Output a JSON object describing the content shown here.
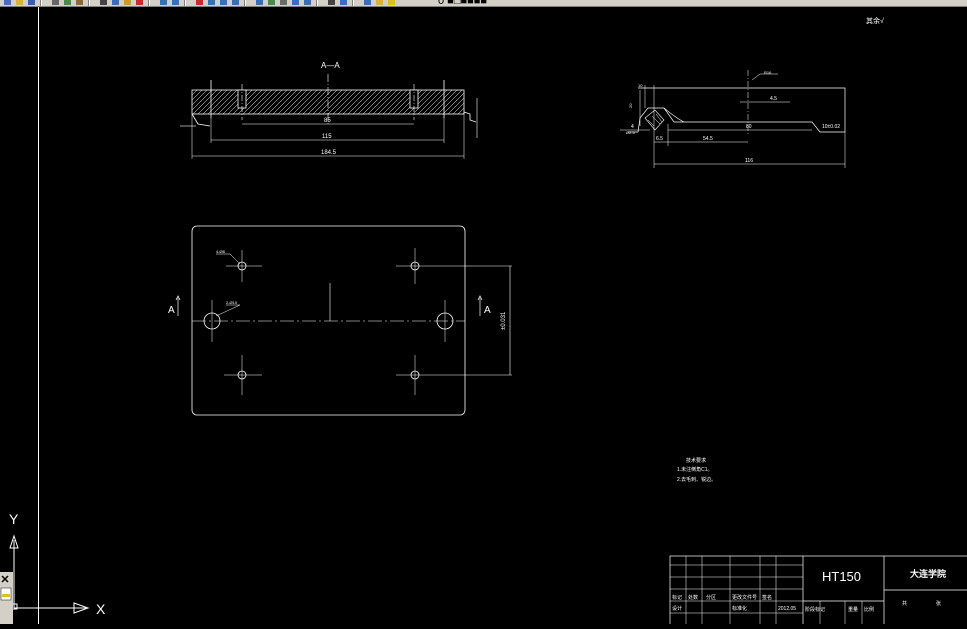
{
  "toolbar": {
    "buttons": [
      {
        "icon": "new-file-icon",
        "color": "#4a6fb5"
      },
      {
        "icon": "open-folder-icon",
        "color": "#d9b23a"
      },
      {
        "icon": "save-icon",
        "color": "#3a5fa8"
      },
      {
        "icon": "print-icon",
        "color": "#666666"
      },
      {
        "icon": "plot-preview-icon",
        "color": "#4a8a4a"
      },
      {
        "icon": "publish-icon",
        "color": "#8a6a3a"
      },
      {
        "icon": "cut-icon",
        "color": "#444444"
      },
      {
        "icon": "copy-icon",
        "color": "#3a6fb5"
      },
      {
        "icon": "paste-icon",
        "color": "#c89a3a"
      },
      {
        "icon": "match-properties-icon",
        "color": "#c03030"
      },
      {
        "icon": "undo-icon",
        "color": "#3a6fb5"
      },
      {
        "icon": "redo-icon",
        "color": "#3a6fb5"
      },
      {
        "icon": "pan-icon",
        "color": "#c03030"
      },
      {
        "icon": "zoom-realtime-icon",
        "color": "#3a6fb5"
      },
      {
        "icon": "zoom-window-icon",
        "color": "#3a6fb5"
      },
      {
        "icon": "zoom-previous-icon",
        "color": "#3a6fb5"
      },
      {
        "icon": "properties-icon",
        "color": "#3a6fb5"
      },
      {
        "icon": "design-center-icon",
        "color": "#4a8a4a"
      },
      {
        "icon": "tool-palettes-icon",
        "color": "#6a6a6a"
      },
      {
        "icon": "sheet-set-icon",
        "color": "#3a6fb5"
      },
      {
        "icon": "markup-icon",
        "color": "#3a6fb5"
      },
      {
        "icon": "calculator-icon",
        "color": "#444444"
      },
      {
        "icon": "help-icon",
        "color": "#3a6fb5"
      },
      {
        "icon": "layer-properties-icon",
        "color": "#3a6fb5"
      },
      {
        "icon": "layer-state-icon",
        "color": "#d9b23a"
      },
      {
        "icon": "layer-light-icon",
        "color": "#e0c020"
      }
    ],
    "layer_text": "0 ■□■■■■"
  },
  "drawing": {
    "section_label": "A—A",
    "section_marker_left": "A",
    "section_marker_right": "A",
    "surface_finish": "其余√",
    "section_dims": {
      "inner": "85",
      "mid": "115",
      "overall": "184.5"
    },
    "plan_dims": {
      "hole_label_1": "4-Ø8",
      "hole_label_2": "2-Ø10",
      "vertical": "±0.031"
    },
    "side_dims": {
      "d1": "4.5",
      "d2": "80",
      "d3": "54.5",
      "d4": "116",
      "d5": "6.5",
      "d6": "4",
      "d7": "Ø2.5",
      "d8": "10",
      "d9": "20",
      "d10": "18.5",
      "d11": "Ø5.5",
      "d12": "10±0.02",
      "d13": "R16"
    },
    "notes": {
      "title": "技术要求",
      "line1": "1.未注倒角C1。",
      "line2": "2.去毛刺、锐边。"
    },
    "title_block": {
      "material": "HT150",
      "school": "大连学院",
      "date": "2012.05",
      "row_mark": "标记",
      "row_count": "处数",
      "row_zone": "分区",
      "row_file": "更改文件号",
      "row_sign": "签名",
      "design": "设计",
      "standard": "标准化",
      "stage": "阶段标记",
      "weight": "重量",
      "ratio": "比例",
      "sheet_total": "共",
      "sheet_no": "张"
    },
    "ucs": {
      "x": "X",
      "y": "Y"
    }
  }
}
